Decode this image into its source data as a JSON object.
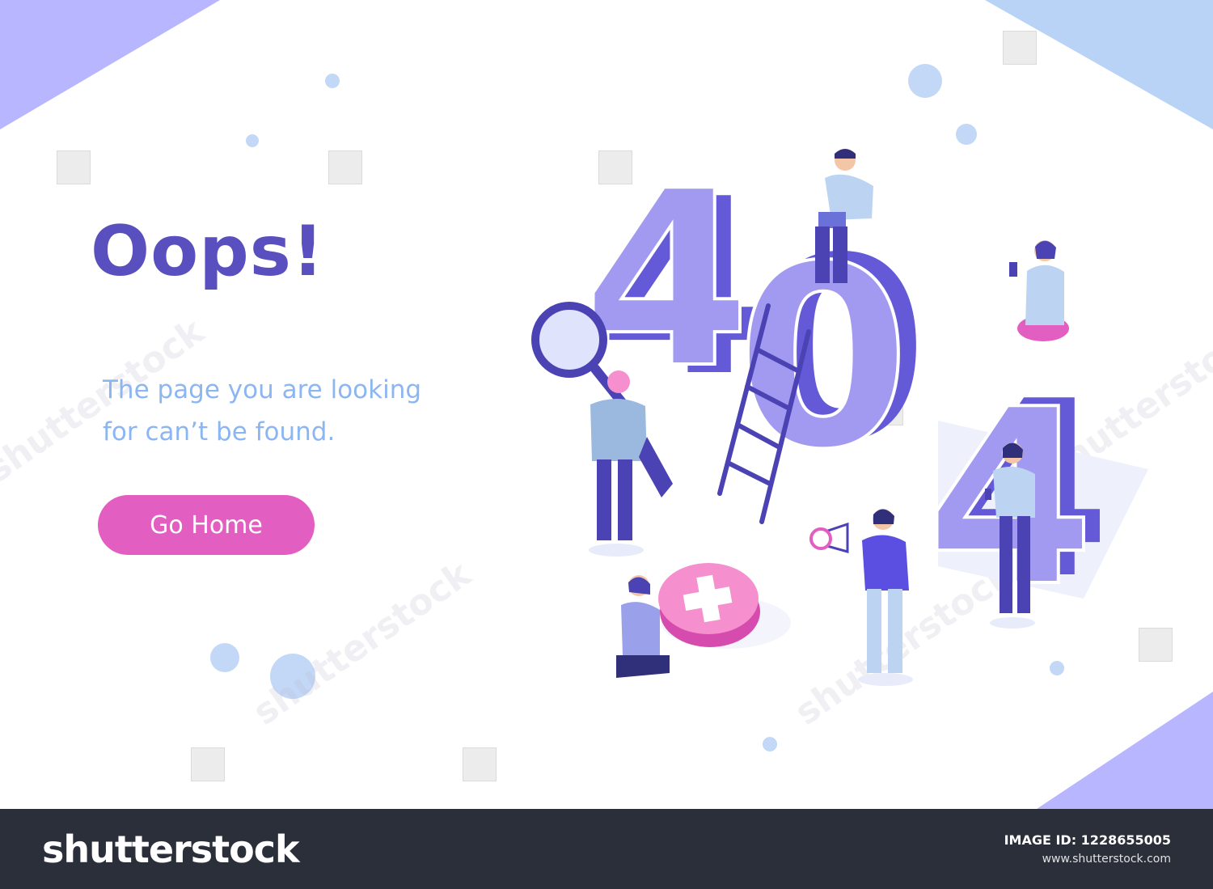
{
  "colors": {
    "background": "#ffffff",
    "headline": "#5a4fbf",
    "message": "#8cb6f2",
    "button_bg": "#e25ec1",
    "button_text": "#ffffff",
    "corner_purple": "#b7b6ff",
    "corner_blue": "#b8d3f5",
    "digit_face": "#a29af0",
    "digit_side": "#6459d6",
    "dot": "#c3d8f6",
    "pink_circle": "#f58fce",
    "footer_bg": "#2b2f3a"
  },
  "hero": {
    "headline": "Oops!",
    "message_line1": "The page you are looking",
    "message_line2": "for can’t be found.",
    "button_label": "Go Home"
  },
  "illustration": {
    "digit1": "4",
    "digit2": "0",
    "digit3": "4",
    "icons": [
      "magnifier-icon",
      "ladder-icon",
      "close-icon",
      "megaphone-icon",
      "laptop-icon",
      "phone-icon"
    ]
  },
  "footer": {
    "brand": "shutterstock",
    "image_id_label": "IMAGE ID: 1228655005",
    "site": "www.shutterstock.com"
  }
}
